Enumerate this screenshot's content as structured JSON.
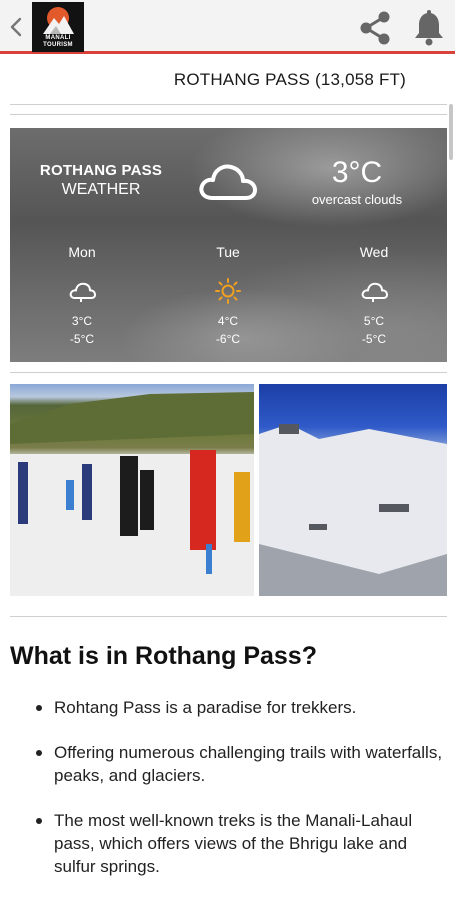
{
  "app": {
    "logo_line1": "MANALI",
    "logo_line2": "TOURISM"
  },
  "header": {
    "title": "ROTHANG PASS (13,058 FT)"
  },
  "weather": {
    "location_line1": "ROTHANG PASS",
    "location_line2": "WEATHER",
    "current_temp": "3°C",
    "current_desc": "overcast clouds",
    "current_icon": "cloud-icon",
    "forecast": [
      {
        "day": "Mon",
        "icon": "cloud-icon",
        "high": "3°C",
        "low": "-5°C"
      },
      {
        "day": "Tue",
        "icon": "sun-icon",
        "high": "4°C",
        "low": "-6°C"
      },
      {
        "day": "Wed",
        "icon": "cloud-icon",
        "high": "5°C",
        "low": "-5°C"
      }
    ],
    "sun_color": "#f0a020"
  },
  "section": {
    "heading": "What is in Rothang Pass?",
    "bullets": [
      "Rohtang Pass is a paradise for trekkers.",
      "Offering numerous challenging trails with waterfalls, peaks, and glaciers.",
      "The most well-known treks is the Manali-Lahaul pass, which offers views of the Bhrigu lake and sulfur springs."
    ]
  },
  "colors": {
    "accent": "#d9413b"
  }
}
